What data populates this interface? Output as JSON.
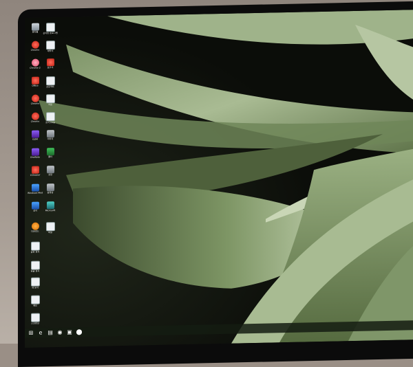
{
  "desktop": {
    "icons": [
      {
        "label": "휴지통",
        "icon": "recycle-bin-icon"
      },
      {
        "label": "설치된 프로그램",
        "icon": "document-icon"
      },
      {
        "label": "Chrome",
        "icon": "app-icon"
      },
      {
        "label": "계약서",
        "icon": "document-icon"
      },
      {
        "label": "Chrome 2",
        "icon": "app-icon"
      },
      {
        "label": "보고서",
        "icon": "document-icon"
      },
      {
        "label": "Office",
        "icon": "app-icon"
      },
      {
        "label": "프로젝트",
        "icon": "document-icon"
      },
      {
        "label": "Chrome",
        "icon": "app-icon"
      },
      {
        "label": "자료",
        "icon": "document-icon"
      },
      {
        "label": "Chrome",
        "icon": "app-icon"
      },
      {
        "label": "문서.hwp",
        "icon": "document-icon"
      },
      {
        "label": "GOM",
        "icon": "player-icon"
      },
      {
        "label": "이미지",
        "icon": "image-icon"
      },
      {
        "label": "OneNote",
        "icon": "app-icon"
      },
      {
        "label": "폴더",
        "icon": "folder-icon"
      },
      {
        "label": "CCleaner",
        "icon": "app-icon"
      },
      {
        "label": "설정",
        "icon": "settings-icon"
      },
      {
        "label": "Windows Media",
        "icon": "app-icon"
      },
      {
        "label": "동영상",
        "icon": "video-icon"
      },
      {
        "label": "설치",
        "icon": "app-icon"
      },
      {
        "label": "Microsoft",
        "icon": "app-icon"
      },
      {
        "label": "다운로드",
        "icon": "app-icon"
      },
      {
        "label": "파일",
        "icon": "document-icon"
      },
      {
        "label": "공유 문서",
        "icon": "document-icon"
      },
      {
        "label": "한글 문서",
        "icon": "document-icon"
      },
      {
        "label": "새 문서",
        "icon": "document-icon"
      },
      {
        "label": "메모",
        "icon": "document-icon"
      },
      {
        "label": "스크린샷",
        "icon": "document-icon"
      }
    ]
  },
  "taskbar": {
    "start": "⊞",
    "items": [
      "e",
      "▤",
      "◉",
      "▣",
      "⬤"
    ]
  }
}
